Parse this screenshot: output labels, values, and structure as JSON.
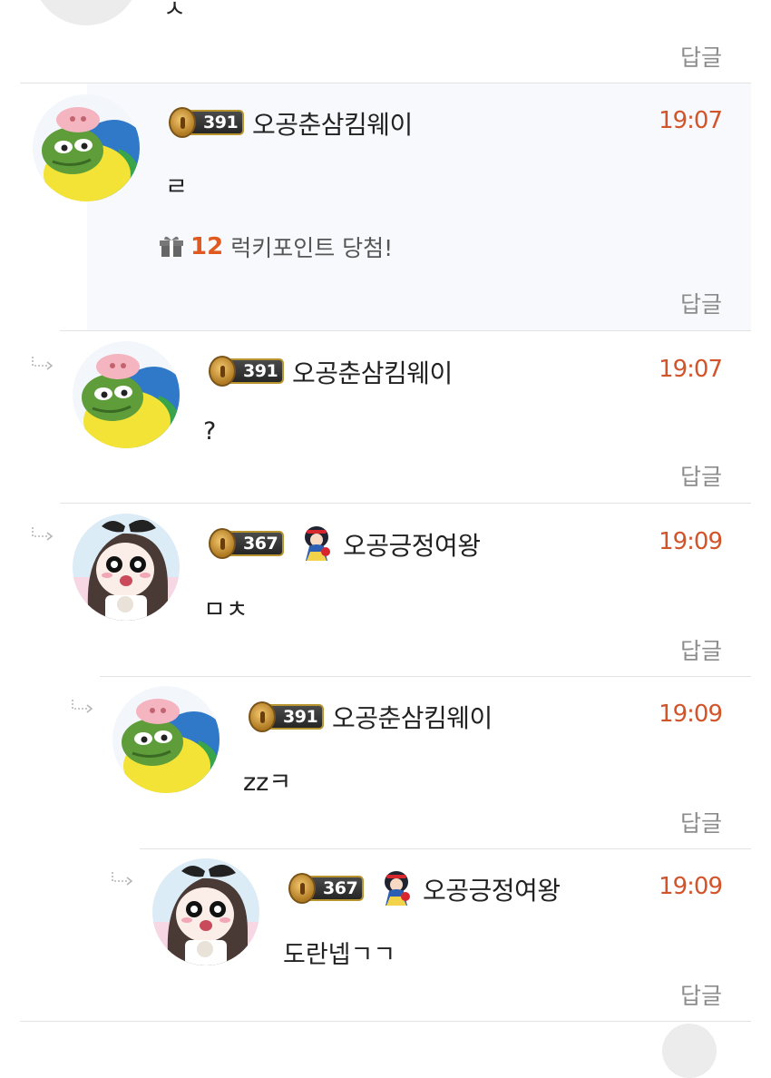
{
  "top_partial": {
    "content": "ㅅ",
    "reply_label": "답글"
  },
  "comments": [
    {
      "level": "391",
      "nickname": "오공춘삼킴웨이",
      "time": "19:07",
      "content": "ㄹ",
      "lucky_points": "12",
      "lucky_text": "럭키포인트 당첨!",
      "reply_label": "답글",
      "avatar": "pepe-parrot"
    },
    {
      "level": "391",
      "nickname": "오공춘삼킴웨이",
      "time": "19:07",
      "content": "?",
      "reply_label": "답글",
      "avatar": "pepe-parrot"
    },
    {
      "level": "367",
      "nickname": "오공긍정여왕",
      "time": "19:09",
      "content": "ㅁㅊ",
      "reply_label": "답글",
      "avatar": "anime-girl",
      "icon": "snow-white-icon"
    },
    {
      "level": "391",
      "nickname": "오공춘삼킴웨이",
      "time": "19:09",
      "content": "zzㅋ",
      "reply_label": "답글",
      "avatar": "pepe-parrot"
    },
    {
      "level": "367",
      "nickname": "오공긍정여왕",
      "time": "19:09",
      "content": "도란넵ㄱㄱ",
      "reply_label": "답글",
      "avatar": "anime-girl",
      "icon": "snow-white-icon"
    }
  ],
  "colors": {
    "time": "#d2542a",
    "lucky_points": "#e0591f",
    "reply": "#8c8c8c",
    "divider": "#e3e3e3",
    "badge_border": "#b8942f"
  }
}
